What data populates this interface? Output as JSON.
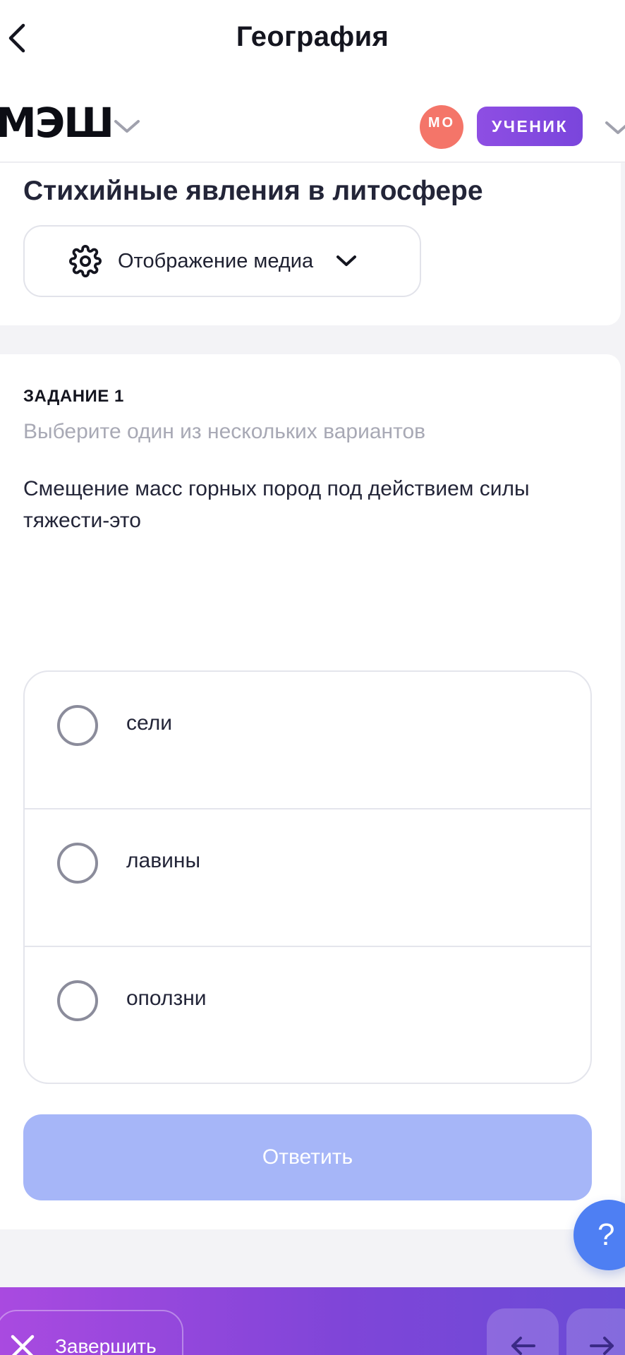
{
  "header": {
    "title": "География",
    "logo_text": "МЭШ",
    "avatar_initials": "МО",
    "role_label": "УЧЕНИК"
  },
  "lesson": {
    "title": "Стихийные явления в литосфере",
    "media_button_label": "Отображение медиа"
  },
  "task": {
    "label": "ЗАДАНИЕ 1",
    "hint": "Выберите один из нескольких вариантов",
    "question": "Смещение масс  горных пород под  действием силы тяжести-это",
    "options": [
      {
        "text": "сели",
        "selected": false
      },
      {
        "text": "лавины",
        "selected": false
      },
      {
        "text": "оползни",
        "selected": false
      }
    ],
    "answer_button_label": "Ответить"
  },
  "help": {
    "label": "?"
  },
  "footer": {
    "finish_label": "Завершить"
  },
  "colors": {
    "accent_purple": "#8e4ee3",
    "avatar_red": "#f47569",
    "answer_disabled": "#a6b6f8",
    "help_blue": "#4e7ff3"
  },
  "icons": {
    "back": "chevron-left-icon",
    "logo_dropdown": "chevron-down-icon",
    "role_dropdown": "chevron-down-icon",
    "media_settings": "gear-icon",
    "media_dropdown": "chevron-down-icon",
    "finish": "close-icon",
    "prev": "arrow-left-icon",
    "next": "arrow-right-icon"
  }
}
